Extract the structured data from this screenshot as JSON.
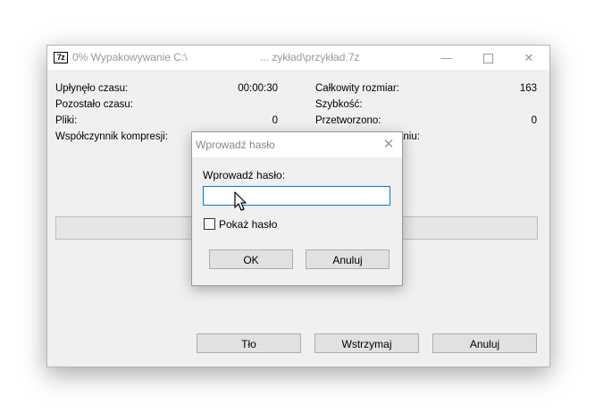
{
  "window": {
    "title_left": "0% Wypakowywanie C:\\",
    "title_right": "... zykład\\przykład.7z",
    "app_icon_text": "7z",
    "min_glyph": "—",
    "close_glyph": "✕"
  },
  "stats": {
    "elapsed_label": "Upłynęło czasu:",
    "elapsed_value": "00:00:30",
    "remaining_label": "Pozostało czasu:",
    "files_label": "Pliki:",
    "files_value": "0",
    "ratio_label": "Współczynnik kompresji:",
    "total_size_label": "Całkowity rozmiar:",
    "total_size_value": "163",
    "speed_label": "Szybkość:",
    "processed_label": "Przetworzono:",
    "processed_value": "0",
    "partial_label": "aniu:"
  },
  "progress": {
    "percent": 0
  },
  "buttons": {
    "background": "Tło",
    "pause": "Wstrzymaj",
    "cancel": "Anuluj"
  },
  "password_dialog": {
    "title": "Wprowadź hasło",
    "close_glyph": "✕",
    "prompt": "Wprowadź hasło:",
    "input_value": "",
    "show_password_label": "Pokaż hasło",
    "show_password_checked": false,
    "ok": "OK",
    "cancel": "Anuluj"
  },
  "colors": {
    "focus_border": "#0078d7",
    "window_bg": "#f0f0f0",
    "title_text": "#999999"
  },
  "icons": [
    "app-7z-icon",
    "minimize-icon",
    "maximize-icon",
    "close-icon",
    "mouse-cursor-icon"
  ]
}
